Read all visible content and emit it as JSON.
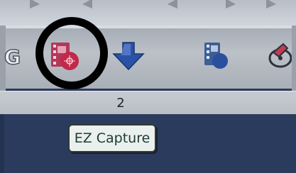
{
  "toolbar": {
    "items": [
      {
        "icon": "format-g-icon"
      },
      {
        "icon": "film-capture-icon"
      },
      {
        "icon": "download-arrow-icon"
      },
      {
        "icon": "film-export-icon"
      },
      {
        "icon": "disc-burn-icon"
      }
    ]
  },
  "pagebar": {
    "page_number": "2"
  },
  "tooltip": {
    "text": "EZ Capture"
  },
  "colors": {
    "accent_red": "#c0294a",
    "arrow_blue": "#2b52a8"
  }
}
